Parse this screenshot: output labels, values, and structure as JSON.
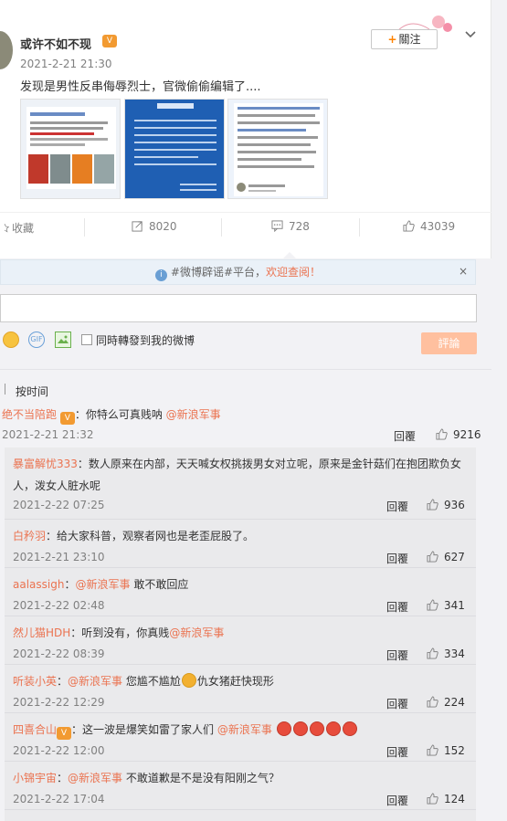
{
  "post": {
    "username": "或许不如不现",
    "vip_badge": "vip-crown-icon",
    "timestamp": "2021-2-21 21:30",
    "text": "发现是男性反串侮辱烈士，官微偷偷编辑了....",
    "follow_label": "關注",
    "follow_plus": "+"
  },
  "actions": {
    "favorite": "收藏",
    "repost": "8020",
    "comment": "728",
    "like": "43039"
  },
  "notice": {
    "text_prefix": "#微博辟谣#平台，",
    "link": "欢迎查阅！",
    "close": "×"
  },
  "composer": {
    "repost_label": "同時轉發到我的微博",
    "submit_label": "評論",
    "gif_label": "GIF"
  },
  "sort": {
    "label": "按时间"
  },
  "top_comment": {
    "author": "绝不当陪跑",
    "text": "：你特么可真贱呐 ",
    "mention": "@新浪军事",
    "time": "2021-2-21 21:32",
    "reply_label": "回覆",
    "likes": "9216"
  },
  "replies": [
    {
      "author": "暴富解忧333",
      "text": "：数人原来在内部，天天喊女权挑拨男女对立呢，原来是金针菇们在抱团欺负女",
      "text2": "人，泼女人脏水呢",
      "time": "2021-2-22 07:25",
      "reply_label": "回覆",
      "likes": "936"
    },
    {
      "author": "白矜羽",
      "text": "：给大家科普，观察者网也是老歪屁股了。",
      "time": "2021-2-21 23:10",
      "reply_label": "回覆",
      "likes": "627"
    },
    {
      "author": "aalassigh",
      "text_pre": "：",
      "mention": "@新浪军事",
      "text": " 敢不敢回应",
      "time": "2021-2-22 02:48",
      "reply_label": "回覆",
      "likes": "341"
    },
    {
      "author": "然儿猫HDH",
      "text": "：听到没有，你真贱",
      "mention": "@新浪军事",
      "time": "2021-2-22 08:39",
      "reply_label": "回覆",
      "likes": "334"
    },
    {
      "author": "听装小英",
      "text_pre": "：",
      "mention": "@新浪军事",
      "text": " 您尴不尴尬",
      "text_post": "仇女猪赶快现形",
      "time": "2021-2-22 12:29",
      "reply_label": "回覆",
      "likes": "224"
    },
    {
      "author": "四喜合山",
      "text": "：这一波是爆笑如雷了家人们 ",
      "mention": "@新浪军事",
      "time": "2021-2-22 12:00",
      "reply_label": "回覆",
      "likes": "152"
    },
    {
      "author": "小锦宇宙",
      "text_pre": "：",
      "mention": "@新浪军事",
      "text": " 不敢道歉是不是没有阳刚之气？",
      "time": "2021-2-22 17:04",
      "reply_label": "回覆",
      "likes": "124"
    }
  ]
}
